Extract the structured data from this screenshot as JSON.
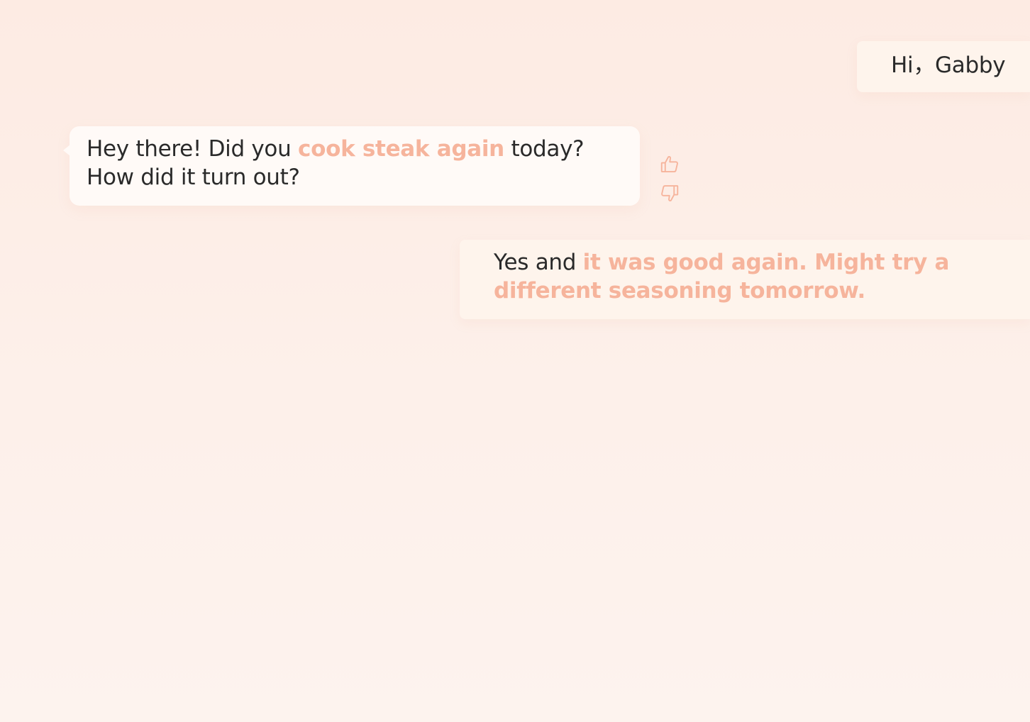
{
  "theme": {
    "accent": "#f6b49c",
    "text": "#2a2a2a",
    "bot_bubble_bg": "#fffaf7",
    "user_bubble_bg": "#fef4ec"
  },
  "messages": {
    "greeting": {
      "text": "Hi，Gabby"
    },
    "bot": {
      "text_before": "Hey there! Did you ",
      "highlight": "cook steak again",
      "text_after": " today? How did it turn out?"
    },
    "user": {
      "text_before": "Yes and ",
      "highlight": "it was good again. Might try a different seasoning tomorrow."
    }
  },
  "feedback": {
    "like_icon": "thumbs-up-icon",
    "dislike_icon": "thumbs-down-icon"
  }
}
